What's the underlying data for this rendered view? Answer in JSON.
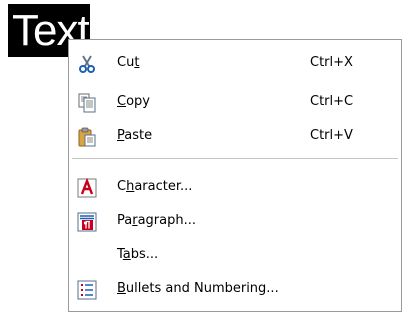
{
  "document": {
    "selected_text": "Text"
  },
  "context_menu": {
    "items": [
      {
        "id": "cut",
        "label_pre": "Cu",
        "label_mnemonic": "t",
        "label_post": "",
        "shortcut": "Ctrl+X",
        "icon": "scissors-icon"
      },
      {
        "id": "copy",
        "label_pre": "",
        "label_mnemonic": "C",
        "label_post": "opy",
        "shortcut": "Ctrl+C",
        "icon": "copy-icon"
      },
      {
        "id": "paste",
        "label_pre": "",
        "label_mnemonic": "P",
        "label_post": "aste",
        "shortcut": "Ctrl+V",
        "icon": "clipboard-paste-icon"
      },
      {
        "id": "character",
        "label_pre": "C",
        "label_mnemonic": "h",
        "label_post": "aracter...",
        "shortcut": "",
        "icon": "character-format-icon"
      },
      {
        "id": "paragraph",
        "label_pre": "Pa",
        "label_mnemonic": "r",
        "label_post": "agraph...",
        "shortcut": "",
        "icon": "paragraph-format-icon"
      },
      {
        "id": "tabs",
        "label_pre": "T",
        "label_mnemonic": "a",
        "label_post": "bs...",
        "shortcut": "",
        "icon": ""
      },
      {
        "id": "bullets",
        "label_pre": "",
        "label_mnemonic": "B",
        "label_post": "ullets and Numbering...",
        "shortcut": "",
        "icon": "bullets-numbering-icon"
      }
    ]
  },
  "colors": {
    "selection_background": "#000000",
    "selection_text": "#ffffff",
    "menu_border": "#9a9a9a",
    "separator": "#c5c5c5",
    "icon_red": "#c8001e",
    "icon_blue": "#1f5fb4"
  }
}
